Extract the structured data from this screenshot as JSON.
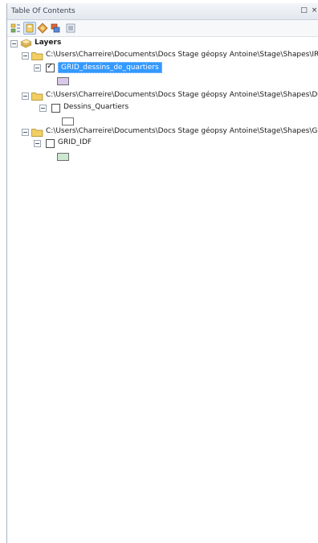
{
  "window": {
    "title": "Table Of Contents",
    "pin_glyph": "□",
    "close_glyph": "×"
  },
  "toolbar": {
    "icons": [
      "list-by-drawing-order-icon",
      "list-by-source-icon",
      "list-by-visibility-icon",
      "list-by-selection-icon",
      "options-icon"
    ]
  },
  "tree": {
    "root_label": "Layers",
    "groups": [
      {
        "path": "C:\\Users\\Charreire\\Documents\\Docs Stage géopsy Antoine\\Stage\\Shapes\\IRIS",
        "layer": "GRID_dessins_de_quartiers",
        "checked": true,
        "selected": true,
        "swatch_color": "#d8c8ea"
      },
      {
        "path": "C:\\Users\\Charreire\\Documents\\Docs Stage géopsy Antoine\\Stage\\Shapes\\Des",
        "layer": "Dessins_Quartiers",
        "checked": false,
        "selected": false,
        "swatch_color": "#ffffff"
      },
      {
        "path": "C:\\Users\\Charreire\\Documents\\Docs Stage géopsy Antoine\\Stage\\Shapes\\GRI",
        "layer": "GRID_IDF",
        "checked": false,
        "selected": false,
        "swatch_color": "#cde8d0"
      }
    ]
  },
  "colors": {
    "selection_bg": "#3399ff",
    "titlebar_bg": "#e3e8ef"
  }
}
